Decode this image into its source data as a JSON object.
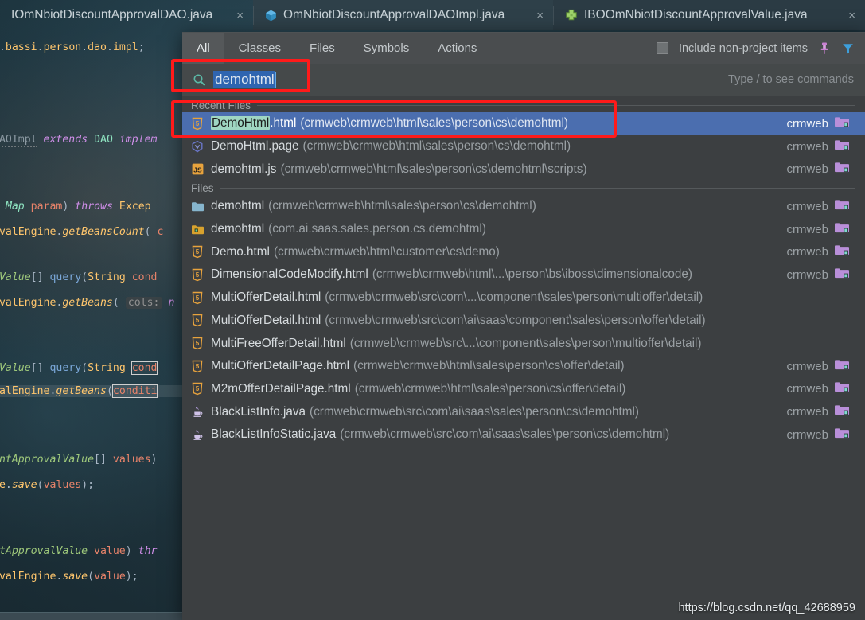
{
  "window": {
    "watermark": "https://blog.csdn.net/qq_42688959"
  },
  "editor_tabs": [
    {
      "label": "IOmNbiotDiscountApprovalDAO.java",
      "icon": "interface-icon",
      "close": "×",
      "active": false
    },
    {
      "label": "OmNbiotDiscountApprovalDAOImpl.java",
      "icon": "class-icon",
      "close": "×",
      "active": false
    },
    {
      "label": "IBOOmNbiotDiscountApprovalValue.java",
      "icon": "interface-plus-icon",
      "close": "×",
      "active": true
    }
  ],
  "editor_code": [
    {
      "text": "z.bassi.person.dao.impl;"
    },
    {
      "text": "DAOImpl extends DAO implem"
    },
    {
      "text": ", Map param) throws Excep"
    },
    {
      "text": "ovalEngine.getBeansCount(c"
    },
    {
      "text": "lValue[] query(String cond"
    },
    {
      "text": "ovalEngine.getBeans( cols: n"
    },
    {
      "text": "lValue[] query(String cond"
    },
    {
      "text": "valEngine.getBeans(conditi"
    },
    {
      "text": "untApprovalValue[] values)"
    },
    {
      "text": "ne.save(values);"
    },
    {
      "text": "ntApprovalValue value) thr"
    },
    {
      "text": "ovalEngine.save(value);"
    }
  ],
  "search_everywhere": {
    "tabs": [
      {
        "label": "All",
        "active": true
      },
      {
        "label": "Classes",
        "active": false
      },
      {
        "label": "Files",
        "active": false
      },
      {
        "label": "Symbols",
        "active": false
      },
      {
        "label": "Actions",
        "active": false
      }
    ],
    "include_non_project": {
      "label_before": "Include ",
      "label_underlined": "n",
      "label_after": "on-project items",
      "checked": false
    },
    "pin_icon": "pin-icon",
    "filter_icon": "filter-icon",
    "search": {
      "icon": "search-icon",
      "value": "demohtml",
      "placeholder": "Type / to see commands",
      "selected": true
    },
    "hint": "Type / to see commands",
    "groups": [
      {
        "title": "Recent Files",
        "items": [
          {
            "icon": "html5-file-icon",
            "match": "DemoHtml",
            "name_rest": ".html",
            "path": "(crmweb\\crmweb\\html\\sales\\person\\cs\\demohtml)",
            "module": "crmweb",
            "module_icon": "module-folder-icon",
            "selected": true
          },
          {
            "icon": "page-file-icon",
            "match": "",
            "name_rest": "DemoHtml.page",
            "path": "(crmweb\\crmweb\\html\\sales\\person\\cs\\demohtml)",
            "module": "crmweb",
            "module_icon": "module-folder-icon",
            "selected": false
          },
          {
            "icon": "js-file-icon",
            "match": "",
            "name_rest": "demohtml.js",
            "path": "(crmweb\\crmweb\\html\\sales\\person\\cs\\demohtml\\scripts)",
            "module": "crmweb",
            "module_icon": "module-folder-icon",
            "selected": false
          }
        ]
      },
      {
        "title": "Files",
        "items": [
          {
            "icon": "folder-icon",
            "match": "",
            "name_rest": "demohtml",
            "path": "(crmweb\\crmweb\\html\\sales\\person\\cs\\demohtml)",
            "module": "crmweb",
            "module_icon": "module-folder-icon",
            "selected": false
          },
          {
            "icon": "package-icon",
            "match": "",
            "name_rest": "demohtml",
            "path": "(com.ai.saas.sales.person.cs.demohtml)",
            "module": "crmweb",
            "module_icon": "module-folder-icon",
            "selected": false
          },
          {
            "icon": "html5-file-icon",
            "match": "",
            "name_rest": "Demo.html",
            "path": "(crmweb\\crmweb\\html\\customer\\cs\\demo)",
            "module": "crmweb",
            "module_icon": "module-folder-icon",
            "selected": false
          },
          {
            "icon": "html5-file-icon",
            "match": "",
            "name_rest": "DimensionalCodeModify.html",
            "path": "(crmweb\\crmweb\\html\\...\\person\\bs\\iboss\\dimensionalcode)",
            "module": "crmweb",
            "module_icon": "module-folder-icon",
            "selected": false
          },
          {
            "icon": "html5-file-icon",
            "match": "",
            "name_rest": "MultiOfferDetail.html",
            "path": "(crmweb\\crmweb\\src\\com\\...\\component\\sales\\person\\multioffer\\detail)",
            "module": "",
            "module_icon": "",
            "selected": false
          },
          {
            "icon": "html5-file-icon",
            "match": "",
            "name_rest": "MultiOfferDetail.html",
            "path": "(crmweb\\crmweb\\src\\com\\ai\\saas\\component\\sales\\person\\offer\\detail)",
            "module": "",
            "module_icon": "",
            "selected": false
          },
          {
            "icon": "html5-file-icon",
            "match": "",
            "name_rest": "MultiFreeOfferDetail.html",
            "path": "(crmweb\\crmweb\\src\\...\\component\\sales\\person\\multioffer\\detail)",
            "module": "",
            "module_icon": "",
            "selected": false
          },
          {
            "icon": "html5-file-icon",
            "match": "",
            "name_rest": "MultiOfferDetailPage.html",
            "path": "(crmweb\\crmweb\\html\\sales\\person\\cs\\offer\\detail)",
            "module": "crmweb",
            "module_icon": "module-folder-icon",
            "selected": false
          },
          {
            "icon": "html5-file-icon",
            "match": "",
            "name_rest": "M2mOfferDetailPage.html",
            "path": "(crmweb\\crmweb\\html\\sales\\person\\cs\\offer\\detail)",
            "module": "crmweb",
            "module_icon": "module-folder-icon",
            "selected": false
          },
          {
            "icon": "java-file-icon",
            "match": "",
            "name_rest": "BlackListInfo.java",
            "path": "(crmweb\\crmweb\\src\\com\\ai\\saas\\sales\\person\\cs\\demohtml)",
            "module": "crmweb",
            "module_icon": "module-folder-icon",
            "selected": false
          },
          {
            "icon": "java-file-icon",
            "match": "",
            "name_rest": "BlackListInfoStatic.java",
            "path": "(crmweb\\crmweb\\src\\com\\ai\\saas\\sales\\person\\cs\\demohtml)",
            "module": "crmweb",
            "module_icon": "module-folder-icon",
            "selected": false
          }
        ]
      }
    ]
  },
  "annotations": [
    {
      "name": "search-field-highlight"
    },
    {
      "name": "selected-result-highlight"
    }
  ],
  "colors": {
    "accent_selection": "#4b6eaf",
    "match_highlight": "#9fd6c2",
    "annotation_red": "#ff1a1a",
    "popup_bg": "#3c3f41",
    "editor_bg": "#21343d"
  }
}
